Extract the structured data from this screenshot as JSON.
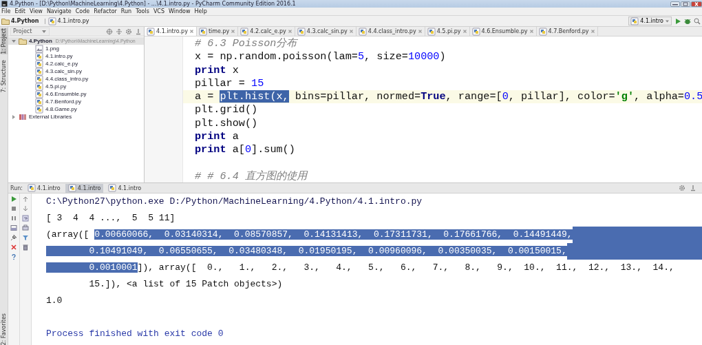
{
  "window": {
    "title": "4.Python - [D:\\Python\\MachineLearning\\4.Python] - ...\\4.1.intro.py - PyCharm Community Edition 2016.1"
  },
  "menu": [
    "File",
    "Edit",
    "View",
    "Navigate",
    "Code",
    "Refactor",
    "Run",
    "Tools",
    "VCS",
    "Window",
    "Help"
  ],
  "breadcrumbs": [
    {
      "label": "4.Python",
      "kind": "folder"
    },
    {
      "label": "4.1.intro.py",
      "kind": "python"
    }
  ],
  "run_config": {
    "label": "4.1.intro"
  },
  "side_tool_tabs": [
    {
      "label": "1: Project",
      "selected": true
    },
    {
      "label": "7: Structure",
      "selected": false
    },
    {
      "label": "2: Favorites",
      "selected": false
    }
  ],
  "project": {
    "title": "Project",
    "tree": [
      {
        "name": "4.Python",
        "path": "D:\\Python\\MachineLearning\\4.Python",
        "kind": "folder",
        "expanded": true,
        "selected": true,
        "children": [
          {
            "name": "1.png",
            "kind": "image",
            "selected": false
          },
          {
            "name": "4.1.intro.py",
            "kind": "python",
            "selected": false
          },
          {
            "name": "4.2.calc_e.py",
            "kind": "python",
            "selected": false
          },
          {
            "name": "4.3.calc_sin.py",
            "kind": "python",
            "selected": false
          },
          {
            "name": "4.4.class_intro.py",
            "kind": "python",
            "selected": false
          },
          {
            "name": "4.5.pi.py",
            "kind": "python",
            "selected": false
          },
          {
            "name": "4.6.Ensumble.py",
            "kind": "python",
            "selected": false
          },
          {
            "name": "4.7.Benford.py",
            "kind": "python",
            "selected": false
          },
          {
            "name": "4.8.Game.py",
            "kind": "python",
            "selected": false
          }
        ]
      },
      {
        "name": "External Libraries",
        "kind": "library",
        "expanded": false,
        "selected": false
      }
    ]
  },
  "editor": {
    "tabs": [
      {
        "label": "4.1.intro.py",
        "selected": true
      },
      {
        "label": "time.py",
        "selected": false
      },
      {
        "label": "4.2.calc_e.py",
        "selected": false
      },
      {
        "label": "4.3.calc_sin.py",
        "selected": false
      },
      {
        "label": "4.4.class_intro.py",
        "selected": false
      },
      {
        "label": "4.5.pi.py",
        "selected": false
      },
      {
        "label": "4.6.Ensumble.py",
        "selected": false
      },
      {
        "label": "4.7.Benford.py",
        "selected": false
      }
    ],
    "lines": [
      {
        "kind": "code",
        "current": false,
        "segments": [
          {
            "text": "# 6.3 Poisson分布",
            "kind": "comment"
          }
        ]
      },
      {
        "kind": "code",
        "current": false,
        "segments": [
          {
            "text": "x = np.random.poisson(lam=",
            "kind": "plain"
          },
          {
            "text": "5",
            "kind": "number"
          },
          {
            "text": ", size=",
            "kind": "plain"
          },
          {
            "text": "10000",
            "kind": "number"
          },
          {
            "text": ")",
            "kind": "plain"
          }
        ]
      },
      {
        "kind": "code",
        "current": false,
        "segments": [
          {
            "text": "print",
            "kind": "keyword"
          },
          {
            "text": " x",
            "kind": "plain"
          }
        ]
      },
      {
        "kind": "code",
        "current": false,
        "segments": [
          {
            "text": "pillar = ",
            "kind": "plain"
          },
          {
            "text": "15",
            "kind": "number"
          }
        ]
      },
      {
        "kind": "code",
        "current": true,
        "segments": [
          {
            "text": "a = ",
            "kind": "plain"
          },
          {
            "text": "plt.hist(x,",
            "kind": "selection"
          },
          {
            "text": " bins=pillar, normed=",
            "kind": "plain"
          },
          {
            "text": "True",
            "kind": "keyword"
          },
          {
            "text": ", range=[",
            "kind": "plain"
          },
          {
            "text": "0",
            "kind": "number"
          },
          {
            "text": ", pillar], color=",
            "kind": "plain"
          },
          {
            "text": "'g'",
            "kind": "string"
          },
          {
            "text": ", alpha=",
            "kind": "plain"
          },
          {
            "text": "0.5",
            "kind": "number"
          }
        ]
      },
      {
        "kind": "code",
        "current": false,
        "segments": [
          {
            "text": "plt.grid()",
            "kind": "plain"
          }
        ]
      },
      {
        "kind": "code",
        "current": false,
        "segments": [
          {
            "text": "plt.show()",
            "kind": "plain"
          }
        ]
      },
      {
        "kind": "code",
        "current": false,
        "segments": [
          {
            "text": "print",
            "kind": "keyword"
          },
          {
            "text": " a",
            "kind": "plain"
          }
        ]
      },
      {
        "kind": "code",
        "current": false,
        "segments": [
          {
            "text": "print",
            "kind": "keyword"
          },
          {
            "text": " a[",
            "kind": "plain"
          },
          {
            "text": "0",
            "kind": "number"
          },
          {
            "text": "].sum()",
            "kind": "plain"
          }
        ]
      },
      {
        "kind": "blank",
        "current": false
      },
      {
        "kind": "code",
        "current": false,
        "segments": [
          {
            "text": "# # 6.4 直方图的使用",
            "kind": "comment"
          }
        ]
      }
    ]
  },
  "run": {
    "label": "Run:",
    "tabs": [
      {
        "label": "4.1.intro",
        "selected": false
      },
      {
        "label": "4.1.intro",
        "selected": true
      },
      {
        "label": "4.1.intro",
        "selected": false
      }
    ],
    "console": [
      {
        "kind": "command",
        "selection_to_end": false,
        "segments": [
          {
            "text": "C:\\Python27\\python.exe D:/Python/MachineLearning/4.Python/4.1.intro.py",
            "kind": "text"
          }
        ]
      },
      {
        "kind": "output",
        "selection_to_end": false,
        "segments": [
          {
            "text": "[ 3  4  4 ...,  5  5 11]",
            "kind": "text"
          }
        ]
      },
      {
        "kind": "output",
        "selection_to_end": true,
        "segments": [
          {
            "text": "(array([ ",
            "kind": "text"
          },
          {
            "text": "0.00660066,  0.03140314,  0.08570857,  0.14131413,  0.17311731,  0.17661766,  0.14491449,",
            "kind": "selection"
          }
        ]
      },
      {
        "kind": "output",
        "selection_to_end": true,
        "segments": [
          {
            "text": "        0.10491049,  0.06550655,  0.03480348,  0.01950195,  0.00960096,  0.00350035,  0.00150015,",
            "kind": "selection"
          }
        ]
      },
      {
        "kind": "output",
        "selection_to_end": false,
        "segments": [
          {
            "text": "        0.0010001",
            "kind": "selection"
          },
          {
            "text": "]), array([  0.,   1.,   2.,   3.,   4.,   5.,   6.,   7.,   8.,   9.,  10.,  11.,  12.,  13.,  14.,",
            "kind": "text"
          }
        ]
      },
      {
        "kind": "output",
        "selection_to_end": false,
        "segments": [
          {
            "text": "        15.]), <a list of 15 Patch objects>)",
            "kind": "text"
          }
        ]
      },
      {
        "kind": "output",
        "selection_to_end": false,
        "segments": [
          {
            "text": "1.0",
            "kind": "text"
          }
        ]
      },
      {
        "kind": "blank",
        "selection_to_end": false
      },
      {
        "kind": "system",
        "selection_to_end": false,
        "segments": [
          {
            "text": "Process finished with exit code 0",
            "kind": "text"
          }
        ]
      }
    ]
  }
}
